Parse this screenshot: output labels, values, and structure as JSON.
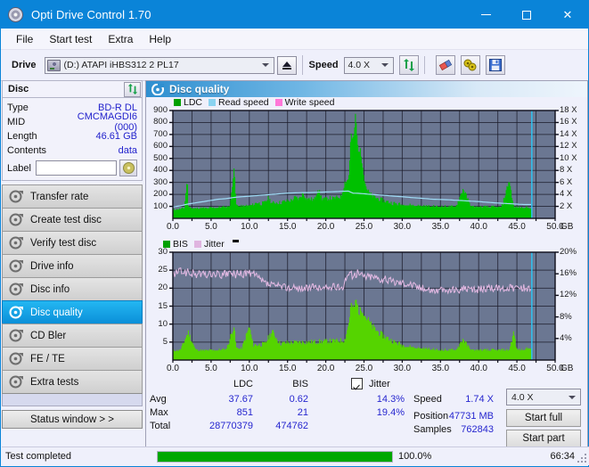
{
  "window": {
    "title": "Opti Drive Control 1.70",
    "icon": "disc-icon",
    "minimize": "─",
    "maximize": "□",
    "close": "✕"
  },
  "menu": [
    "File",
    "Start test",
    "Extra",
    "Help"
  ],
  "toolbar": {
    "drive_label": "Drive",
    "drive_value": "(D:)  ATAPI iHBS312  2 PL17",
    "eject": "eject-button",
    "speed_label": "Speed",
    "speed_value": "4.0 X",
    "refresh": "refresh-icon",
    "erase": "erase-icon",
    "tools": "tools-icon",
    "save": "save-icon"
  },
  "disc_panel": {
    "title": "Disc",
    "refresh_icon": "refresh-icon",
    "rows": [
      {
        "key": "Type",
        "value": "BD-R DL"
      },
      {
        "key": "MID",
        "value": "CMCMAGDI6 (000)"
      },
      {
        "key": "Length",
        "value": "46.61 GB"
      },
      {
        "key": "Contents",
        "value": "data"
      }
    ],
    "label_key": "Label",
    "label_value": "",
    "cd_button": "disc-icon"
  },
  "nav": {
    "items": [
      {
        "label": "Transfer rate",
        "active": false
      },
      {
        "label": "Create test disc",
        "active": false
      },
      {
        "label": "Verify test disc",
        "active": false
      },
      {
        "label": "Drive info",
        "active": false
      },
      {
        "label": "Disc info",
        "active": false
      },
      {
        "label": "Disc quality",
        "active": true
      },
      {
        "label": "CD Bler",
        "active": false
      },
      {
        "label": "FE / TE",
        "active": false
      },
      {
        "label": "Extra tests",
        "active": false
      }
    ],
    "status_window": "Status window > >"
  },
  "main": {
    "title": "Disc quality",
    "icon": "disc-quality-icon"
  },
  "chart_data": [
    {
      "type": "area",
      "name": "ldc-chart",
      "title": "",
      "xlabel": "GB",
      "ylabel": "",
      "legend": [
        {
          "label": "LDC",
          "color": "#00a000"
        },
        {
          "label": "Read speed",
          "color": "#8ad3f0"
        },
        {
          "label": "Write speed",
          "color": "#ff77d8"
        }
      ],
      "legend_position": "top-left",
      "grid": true,
      "xlim": [
        0,
        50
      ],
      "ylim": [
        0,
        900
      ],
      "xticks": [
        "0.0",
        "5.0",
        "10.0",
        "15.0",
        "20.0",
        "25.0",
        "30.0",
        "35.0",
        "40.0",
        "45.0",
        "50.0"
      ],
      "yticks": [
        "100",
        "200",
        "300",
        "400",
        "500",
        "600",
        "700",
        "800",
        "900"
      ],
      "y2lim": [
        0,
        18
      ],
      "y2ticks": [
        "2 X",
        "4 X",
        "6 X",
        "8 X",
        "10 X",
        "12 X",
        "14 X",
        "16 X",
        "18 X"
      ],
      "series": [
        {
          "name": "LDC",
          "color": "#00c000",
          "kind": "area",
          "x": [
            0.0,
            0.5,
            1.0,
            1.5,
            1.9,
            2.0,
            2.4,
            3.0,
            3.5,
            4.0,
            4.5,
            5.0,
            5.5,
            6.0,
            6.5,
            7.0,
            7.5,
            8.0,
            8.3,
            8.6,
            9.0,
            9.5,
            10.0,
            10.5,
            11.0,
            11.5,
            12.0,
            12.5,
            13.0,
            13.5,
            14.0,
            14.5,
            15.0,
            15.5,
            16.0,
            16.5,
            17.0,
            17.5,
            18.0,
            18.5,
            19.0,
            19.5,
            20.0,
            20.5,
            21.0,
            21.5,
            22.0,
            22.5,
            23.0,
            23.3,
            23.6,
            23.9,
            24.2,
            24.5,
            24.8,
            25.1,
            25.5,
            26.0,
            26.5,
            27.0,
            27.5,
            28.0,
            28.5,
            29.0,
            29.5,
            30.0,
            31.0,
            32.0,
            33.0,
            34.0,
            35.0,
            36.0,
            37.0,
            38.0,
            38.3,
            39.0,
            40.0,
            41.0,
            42.0,
            43.0,
            44.0,
            44.6,
            45.0,
            46.0,
            46.8,
            47.0
          ],
          "y": [
            70,
            70,
            75,
            80,
            340,
            95,
            85,
            78,
            80,
            82,
            78,
            85,
            85,
            88,
            90,
            92,
            95,
            430,
            110,
            100,
            95,
            100,
            105,
            110,
            135,
            120,
            130,
            170,
            125,
            135,
            130,
            140,
            145,
            150,
            175,
            160,
            210,
            165,
            160,
            155,
            250,
            165,
            160,
            170,
            165,
            175,
            180,
            300,
            330,
            700,
            640,
            860,
            600,
            560,
            470,
            300,
            230,
            190,
            175,
            160,
            150,
            140,
            130,
            125,
            118,
            112,
            108,
            102,
            98,
            96,
            95,
            94,
            92,
            250,
            200,
            95,
            90,
            92,
            90,
            88,
            320,
            90,
            88,
            86,
            84,
            0
          ]
        },
        {
          "name": "Read speed",
          "color": "#9fdcf6",
          "kind": "line",
          "axis": "y2",
          "x": [
            0.0,
            1.0,
            2.0,
            3.0,
            4.0,
            5.0,
            6.0,
            7.0,
            8.0,
            9.0,
            10.0,
            11.0,
            12.0,
            13.0,
            14.0,
            15.0,
            16.0,
            17.0,
            18.0,
            19.0,
            20.0,
            21.0,
            22.0,
            23.0,
            23.5,
            24.0,
            25.0,
            26.0,
            27.0,
            28.0,
            29.0,
            30.0,
            32.0,
            34.0,
            36.0,
            38.0,
            40.0,
            42.0,
            44.0,
            46.0,
            46.9
          ],
          "y": [
            1.9,
            2.1,
            2.4,
            2.6,
            2.8,
            3.0,
            3.2,
            3.3,
            3.5,
            3.6,
            3.7,
            3.8,
            3.9,
            4.0,
            4.1,
            4.2,
            4.25,
            4.3,
            4.3,
            4.35,
            4.4,
            4.45,
            4.5,
            4.55,
            4.2,
            4.2,
            4.1,
            4.0,
            3.9,
            3.8,
            3.7,
            3.6,
            3.4,
            3.2,
            3.1,
            2.95,
            2.8,
            2.6,
            2.45,
            2.3,
            2.3
          ]
        }
      ],
      "marker_line": {
        "x": 46.95,
        "color": "#2ac6f5"
      }
    },
    {
      "type": "area",
      "name": "bis-jitter-chart",
      "title": "",
      "xlabel": "GB",
      "ylabel": "",
      "legend": [
        {
          "label": "BIS",
          "color": "#00a000"
        },
        {
          "label": "Jitter",
          "color": "#e0b4e0"
        }
      ],
      "legend_position": "top-left",
      "grid": true,
      "xlim": [
        0,
        50
      ],
      "ylim": [
        0,
        30
      ],
      "xticks": [
        "0.0",
        "5.0",
        "10.0",
        "15.0",
        "20.0",
        "25.0",
        "30.0",
        "35.0",
        "40.0",
        "45.0",
        "50.0"
      ],
      "yticks": [
        "5",
        "10",
        "15",
        "20",
        "25",
        "30"
      ],
      "y2lim": [
        0,
        20
      ],
      "y2ticks": [
        "4%",
        "8%",
        "12%",
        "16%",
        "20%"
      ],
      "series": [
        {
          "name": "BIS",
          "color": "#55d400",
          "kind": "area",
          "x": [
            0.0,
            1.0,
            2.0,
            3.0,
            4.0,
            5.0,
            6.0,
            7.0,
            8.0,
            8.3,
            9.0,
            10.0,
            10.5,
            11.0,
            12.0,
            13.0,
            14.0,
            15.0,
            16.0,
            17.0,
            18.0,
            19.0,
            20.0,
            21.0,
            22.0,
            22.5,
            23.0,
            23.3,
            23.6,
            24.0,
            24.4,
            24.8,
            25.2,
            25.6,
            26.0,
            26.5,
            27.0,
            27.5,
            28.0,
            28.5,
            29.0,
            29.5,
            30.0,
            31.0,
            32.0,
            33.0,
            34.0,
            35.0,
            36.0,
            37.0,
            38.0,
            38.3,
            39.0,
            40.0,
            41.0,
            42.0,
            43.0,
            44.0,
            44.6,
            45.0,
            46.0,
            46.8,
            47.0
          ],
          "y": [
            2.4,
            2.6,
            7.8,
            2.6,
            2.5,
            2.6,
            2.7,
            2.8,
            9.5,
            3.2,
            3.0,
            9.3,
            4.3,
            4.2,
            4.4,
            8.0,
            4.6,
            4.8,
            4.9,
            5.0,
            5.0,
            5.1,
            5.2,
            5.3,
            5.4,
            5.6,
            10.0,
            15.5,
            14.0,
            16.5,
            13.0,
            14.5,
            12.0,
            11.0,
            9.5,
            8.5,
            7.5,
            6.8,
            6.2,
            5.6,
            5.0,
            4.6,
            4.2,
            3.6,
            3.2,
            3.0,
            2.8,
            2.6,
            2.6,
            2.6,
            6.0,
            4.6,
            2.6,
            2.6,
            2.6,
            2.6,
            2.6,
            2.6,
            7.8,
            2.6,
            2.8,
            3.3,
            0
          ]
        },
        {
          "name": "Jitter",
          "color": "#e3b9e3",
          "kind": "line",
          "axis": "y2",
          "x": [
            0.0,
            0.6,
            1.2,
            1.8,
            2.4,
            3.0,
            3.6,
            4.2,
            4.8,
            5.4,
            6.0,
            6.6,
            7.2,
            7.8,
            8.4,
            9.0,
            9.6,
            10.2,
            10.8,
            11.4,
            12.0,
            12.6,
            13.2,
            13.8,
            14.4,
            15.0,
            15.6,
            16.2,
            16.8,
            17.4,
            18.0,
            18.6,
            19.2,
            19.8,
            20.4,
            21.0,
            21.6,
            22.2,
            22.8,
            23.0,
            23.4,
            24.0,
            24.6,
            25.2,
            25.8,
            26.4,
            27.0,
            27.6,
            28.2,
            28.8,
            29.4,
            30.0,
            31.0,
            32.0,
            33.0,
            34.0,
            35.0,
            36.0,
            37.0,
            38.0,
            39.0,
            40.0,
            41.0,
            42.0,
            43.0,
            44.0,
            45.0,
            46.0,
            46.9
          ],
          "y": [
            15.7,
            16.3,
            16.5,
            16.2,
            16.1,
            15.9,
            16.0,
            15.8,
            15.9,
            16.0,
            15.8,
            15.7,
            16.1,
            15.9,
            16.0,
            15.8,
            16.2,
            16.0,
            15.6,
            14.9,
            14.3,
            14.0,
            13.8,
            13.7,
            13.6,
            13.5,
            13.4,
            13.3,
            13.4,
            13.3,
            13.4,
            13.5,
            13.4,
            13.3,
            13.5,
            13.6,
            13.4,
            13.6,
            15.8,
            16.0,
            15.7,
            16.1,
            15.8,
            15.5,
            15.6,
            15.4,
            15.2,
            15.0,
            14.8,
            14.6,
            14.5,
            14.4,
            14.2,
            13.6,
            13.2,
            13.0,
            12.9,
            12.9,
            13.0,
            13.2,
            13.0,
            13.1,
            13.3,
            13.2,
            13.4,
            13.3,
            13.5,
            13.4,
            13.4
          ]
        }
      ],
      "marker_line": {
        "x": 46.95,
        "color": "#2ac6f5"
      }
    }
  ],
  "stats": {
    "col_headers": [
      "LDC",
      "BIS"
    ],
    "jitter_label": "Jitter",
    "jitter_checked": true,
    "rows": [
      {
        "label": "Avg",
        "ldc": "37.67",
        "bis": "0.62",
        "jitter": "14.3%"
      },
      {
        "label": "Max",
        "ldc": "851",
        "bis": "21",
        "jitter": "19.4%"
      },
      {
        "label": "Total",
        "ldc": "28770379",
        "bis": "474762",
        "jitter": ""
      }
    ],
    "speed_label": "Speed",
    "speed_value": "1.74 X",
    "position_label": "Position",
    "position_value": "47731 MB",
    "samples_label": "Samples",
    "samples_value": "762843",
    "speed_select": "4.0 X",
    "start_full": "Start full",
    "start_part": "Start part"
  },
  "statusbar": {
    "text": "Test completed",
    "progress_pct": 100.0,
    "progress_label": "100.0%",
    "time": "66:34"
  }
}
